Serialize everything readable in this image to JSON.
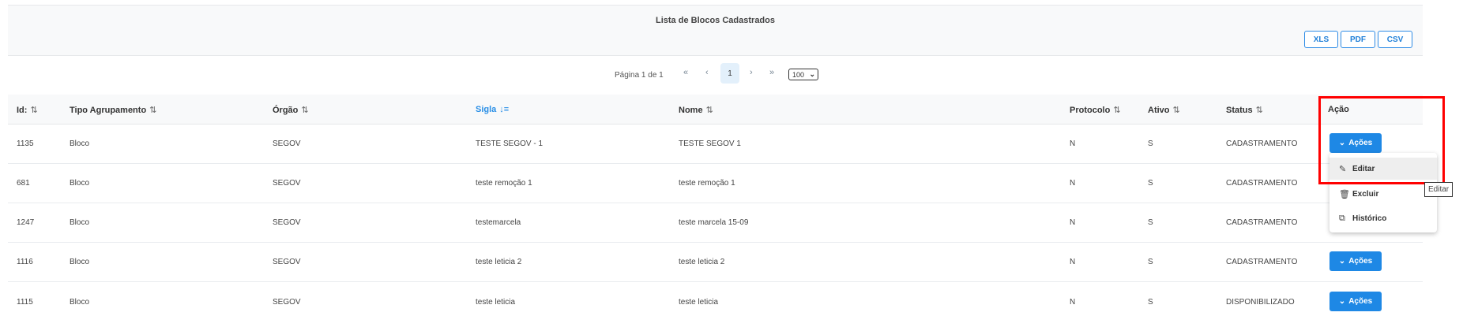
{
  "panel": {
    "title": "Lista de Blocos Cadastrados"
  },
  "export": {
    "xls": "XLS",
    "pdf": "PDF",
    "csv": "CSV"
  },
  "pagination": {
    "info": "Página 1 de 1",
    "first": "«",
    "prev": "‹",
    "current": "1",
    "next": "›",
    "last": "»",
    "per_page": "100"
  },
  "columns": {
    "id": "Id:",
    "tipo": "Tipo Agrupamento",
    "orgao": "Órgão",
    "sigla": "Sigla",
    "nome": "Nome",
    "protocolo": "Protocolo",
    "ativo": "Ativo",
    "status": "Status",
    "acao": "Ação"
  },
  "sort_icons": {
    "neutral": "⇅",
    "desc": "↓≡"
  },
  "rows": [
    {
      "id": "1135",
      "tipo": "Bloco",
      "orgao": "SEGOV",
      "sigla": "TESTE SEGOV - 1",
      "nome": "TESTE SEGOV 1",
      "protocolo": "N",
      "ativo": "S",
      "status": "CADASTRAMENTO"
    },
    {
      "id": "681",
      "tipo": "Bloco",
      "orgao": "SEGOV",
      "sigla": "teste remoção 1",
      "nome": "teste remoção 1",
      "protocolo": "N",
      "ativo": "S",
      "status": "CADASTRAMENTO"
    },
    {
      "id": "1247",
      "tipo": "Bloco",
      "orgao": "SEGOV",
      "sigla": "testemarcela",
      "nome": "teste marcela 15-09",
      "protocolo": "N",
      "ativo": "S",
      "status": "CADASTRAMENTO"
    },
    {
      "id": "1116",
      "tipo": "Bloco",
      "orgao": "SEGOV",
      "sigla": "teste leticia 2",
      "nome": "teste leticia 2",
      "protocolo": "N",
      "ativo": "S",
      "status": "CADASTRAMENTO"
    },
    {
      "id": "1115",
      "tipo": "Bloco",
      "orgao": "SEGOV",
      "sigla": "teste leticia",
      "nome": "teste leticia",
      "protocolo": "N",
      "ativo": "S",
      "status": "DISPONIBILIZADO"
    }
  ],
  "actions_button": "Ações",
  "actions_menu": [
    {
      "label": "Editar",
      "icon": "pencil-icon"
    },
    {
      "label": "Excluir",
      "icon": "trash-icon"
    },
    {
      "label": "Histórico",
      "icon": "history-icon"
    }
  ],
  "tooltip": "Editar",
  "colors": {
    "primary": "#1e88e5",
    "highlight": "#ff0000",
    "active_sort": "#2a8fe6"
  }
}
